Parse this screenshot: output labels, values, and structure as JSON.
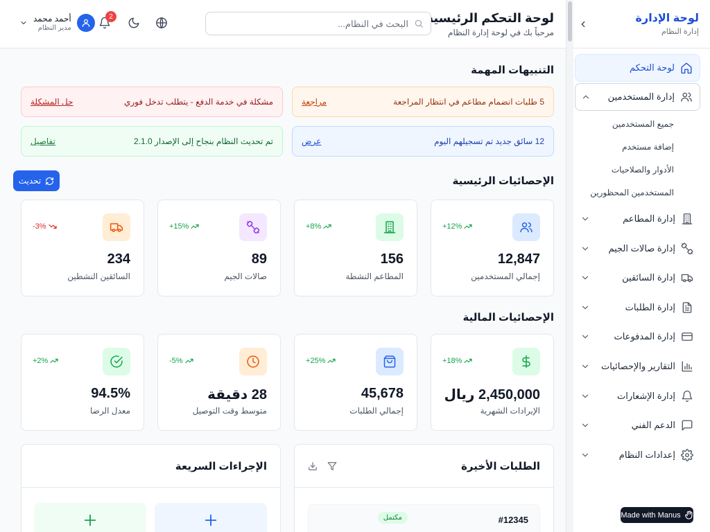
{
  "sidebar": {
    "title": "لوحة الإدارة",
    "subtitle": "إدارة النظام",
    "items": [
      {
        "label": "لوحة التحكم",
        "icon": "home-icon"
      },
      {
        "label": "إدارة المستخدمين",
        "icon": "users-icon"
      },
      {
        "label": "إدارة المطاعم",
        "icon": "building-icon"
      },
      {
        "label": "إدارة صالات الجيم",
        "icon": "dumbbell-icon"
      },
      {
        "label": "إدارة السائقين",
        "icon": "truck-icon"
      },
      {
        "label": "إدارة الطلبات",
        "icon": "document-icon"
      },
      {
        "label": "إدارة المدفوعات",
        "icon": "credit-card-icon"
      },
      {
        "label": "التقارير والإحصائيات",
        "icon": "bar-chart-icon"
      },
      {
        "label": "إدارة الإشعارات",
        "icon": "bell-icon"
      },
      {
        "label": "الدعم الفني",
        "icon": "message-icon"
      },
      {
        "label": "إعدادات النظام",
        "icon": "gear-icon"
      }
    ],
    "users_sub": [
      "جميع المستخدمين",
      "إضافة مستخدم",
      "الأدوار والصلاحيات",
      "المستخدمين المحظورين"
    ]
  },
  "header": {
    "title": "لوحة التحكم الرئيسية",
    "subtitle": "مرحباً بك في لوحة إدارة النظام",
    "search_placeholder": "البحث في النظام...",
    "notification_count": "2",
    "user_name": "أحمد محمد",
    "user_role": "مدير النظام"
  },
  "alerts": {
    "title": "التنبيهات المهمة",
    "items": [
      {
        "text": "5 طلبات انضمام مطاعم في انتظار المراجعة",
        "action": "مراجعة",
        "color": "orange"
      },
      {
        "text": "مشكلة في خدمة الدفع - يتطلب تدخل فوري",
        "action": "حل المشكلة",
        "color": "red"
      },
      {
        "text": "12 سائق جديد تم تسجيلهم اليوم",
        "action": "عرض",
        "color": "blue"
      },
      {
        "text": "تم تحديث النظام بنجاح إلى الإصدار 2.1.0",
        "action": "تفاصيل",
        "color": "green"
      }
    ]
  },
  "main_stats": {
    "title": "الإحصائيات الرئيسية",
    "refresh_label": "تحديث",
    "cards": [
      {
        "value": "12,847",
        "label": "إجمالي المستخدمين",
        "change": "+12%",
        "trend": "up",
        "icon": "users-icon",
        "color": "#2563eb",
        "bg": "#dbeafe"
      },
      {
        "value": "156",
        "label": "المطاعم النشطة",
        "change": "+8%",
        "trend": "up",
        "icon": "building-icon",
        "color": "#16a34a",
        "bg": "#dcfce7"
      },
      {
        "value": "89",
        "label": "صالات الجيم",
        "change": "+15%",
        "trend": "up",
        "icon": "dumbbell-icon",
        "color": "#9333ea",
        "bg": "#f3e8ff"
      },
      {
        "value": "234",
        "label": "السائقين النشطين",
        "change": "-3%",
        "trend": "down",
        "icon": "truck-icon",
        "color": "#ea580c",
        "bg": "#ffedd5"
      }
    ]
  },
  "financial_stats": {
    "title": "الإحصائيات المالية",
    "cards": [
      {
        "value": "2,450,000 ريال",
        "label": "الإيرادات الشهرية",
        "change": "+18%",
        "trend": "up",
        "icon": "dollar-icon",
        "color": "#16a34a",
        "bg": "#dcfce7"
      },
      {
        "value": "45,678",
        "label": "إجمالي الطلبات",
        "change": "+25%",
        "trend": "up",
        "icon": "shopping-bag-icon",
        "color": "#2563eb",
        "bg": "#dbeafe"
      },
      {
        "value": "28 دقيقة",
        "label": "متوسط وقت التوصيل",
        "change": "-5%",
        "trend": "up",
        "icon": "clock-icon",
        "color": "#ea580c",
        "bg": "#ffedd5"
      },
      {
        "value": "94.5%",
        "label": "معدل الرضا",
        "change": "+2%",
        "trend": "up",
        "icon": "check-circle-icon",
        "color": "#16a34a",
        "bg": "#dcfce7"
      }
    ]
  },
  "recent_orders": {
    "title": "الطلبات الأخيرة",
    "orders": [
      {
        "id": "#12345",
        "status": "مكتمل"
      }
    ]
  },
  "quick_actions": {
    "title": "الإجراءات السريعة"
  },
  "made_with": "Made with Manus"
}
